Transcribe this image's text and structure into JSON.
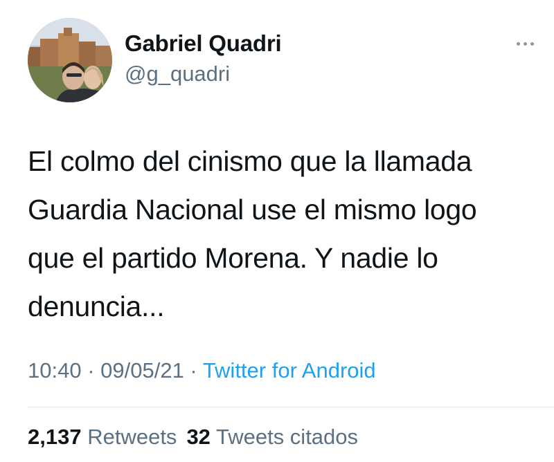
{
  "author": {
    "name": "Gabriel Quadri",
    "handle": "@g_quadri",
    "avatar": "profile-photo"
  },
  "menu_icon": "more-horizontal-icon",
  "tweet": {
    "lines": [
      "El colmo del cinismo que la llamada",
      "Guardia Nacional use el mismo logo",
      "que el partido Morena. Y nadie lo",
      "denuncia..."
    ]
  },
  "meta": {
    "time": "10:40",
    "separator": " · ",
    "date": "09/05/21",
    "source": "Twitter for Android"
  },
  "stats": {
    "retweets_count": "2,137",
    "retweets_label": "Retweets",
    "quotes_count": "32",
    "quotes_label": "Tweets citados"
  },
  "colors": {
    "text": "#0f1419",
    "secondary": "#5b7083",
    "link": "#1da1f2",
    "divider": "#e1e8ed"
  }
}
